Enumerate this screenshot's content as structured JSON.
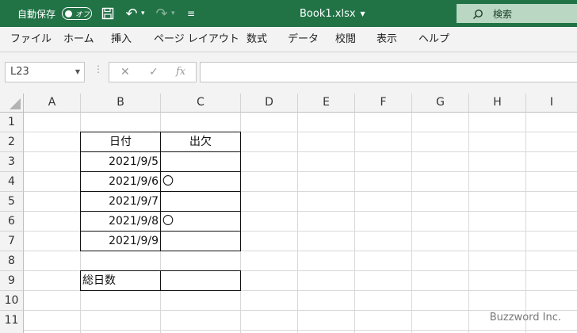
{
  "titlebar": {
    "autosave_label": "自動保存",
    "autosave_state": "オフ",
    "document_title": "Book1.xlsx",
    "search_placeholder": "検索",
    "accent": "#217346"
  },
  "ribbon_tabs": [
    "ファイル",
    "ホーム",
    "挿入",
    "ページ レイアウト",
    "数式",
    "データ",
    "校閲",
    "表示",
    "ヘルプ"
  ],
  "formula_bar": {
    "name_box": "L23",
    "cancel_icon": "✕",
    "enter_icon": "✓",
    "fx_label": "fx",
    "formula": ""
  },
  "sheet": {
    "columns": [
      "A",
      "B",
      "C",
      "D",
      "E",
      "F",
      "G",
      "H",
      "I"
    ],
    "rows": [
      "1",
      "2",
      "3",
      "4",
      "5",
      "6",
      "7",
      "8",
      "9",
      "10",
      "11"
    ],
    "table_header": {
      "B2": "日付",
      "C2": "出欠"
    },
    "table_rows": [
      {
        "date": "2021/9/5",
        "attendance": ""
      },
      {
        "date": "2021/9/6",
        "attendance": "〇"
      },
      {
        "date": "2021/9/7",
        "attendance": ""
      },
      {
        "date": "2021/9/8",
        "attendance": "〇"
      },
      {
        "date": "2021/9/9",
        "attendance": ""
      }
    ],
    "total_label": "総日数",
    "total_value": ""
  },
  "watermark": "Buzzword Inc."
}
